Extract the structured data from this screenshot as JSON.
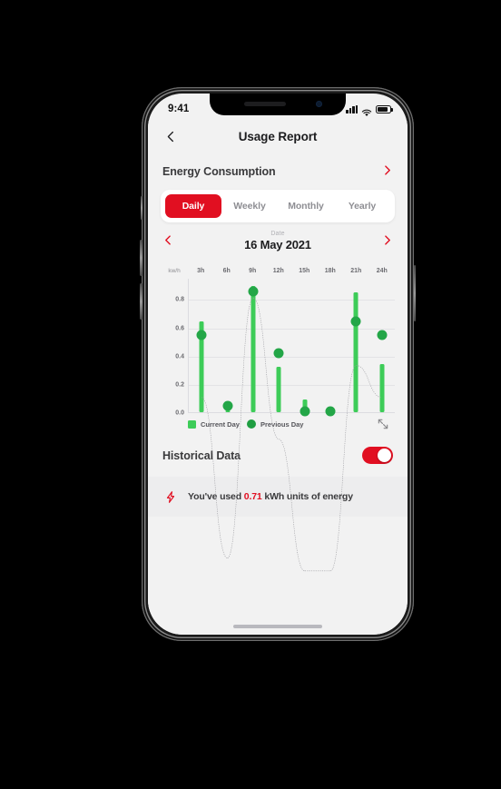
{
  "status_bar": {
    "time": "9:41",
    "signal_icon": "signal-bars-icon",
    "wifi_icon": "wifi-icon",
    "battery_icon": "battery-icon"
  },
  "nav": {
    "back_icon": "chevron-left-icon",
    "title": "Usage Report"
  },
  "section": {
    "title": "Energy Consumption",
    "chevron_icon": "chevron-right-icon"
  },
  "tabs": [
    {
      "label": "Daily",
      "active": true
    },
    {
      "label": "Weekly",
      "active": false
    },
    {
      "label": "Monthly",
      "active": false
    },
    {
      "label": "Yearly",
      "active": false
    }
  ],
  "date_picker": {
    "prev_icon": "chevron-left-icon",
    "next_icon": "chevron-right-icon",
    "label": "Date",
    "value": "16 May 2021"
  },
  "legend": {
    "current_label": "Current Day",
    "previous_label": "Previous Day",
    "expand_icon": "expand-diagonal-icon"
  },
  "historical": {
    "title": "Historical Data",
    "toggle_state": "on"
  },
  "banner": {
    "icon": "lightning-bolt-icon",
    "prefix": "You've used ",
    "value": "0.71",
    "suffix": " kWh units of energy"
  },
  "colors": {
    "brand_red": "#e10f21",
    "bar_green": "#3dcc58",
    "dot_green": "#23a647",
    "screen_bg": "#f2f2f2",
    "card_bg": "#ffffff"
  },
  "chart_data": {
    "type": "bar",
    "title": "",
    "xlabel": "",
    "ylabel": "kw/h",
    "unit_label": "kw/h",
    "categories": [
      "3h",
      "6h",
      "9h",
      "12h",
      "15h",
      "18h",
      "21h",
      "24h"
    ],
    "x_tick_labels": [
      "3h",
      "6h",
      "9h",
      "12h",
      "15h",
      "18h",
      "21h",
      "24h"
    ],
    "y_tick_labels": [
      "0.0",
      "0.2",
      "0.4",
      "0.6",
      "0.8"
    ],
    "y_ticks": [
      0.0,
      0.2,
      0.4,
      0.6,
      0.8
    ],
    "ylim": [
      0,
      0.95
    ],
    "grid": true,
    "legend_position": "bottom-left",
    "series": [
      {
        "name": "Current Day",
        "type": "bar",
        "color": "#3dcc58",
        "values": [
          0.64,
          0.01,
          0.89,
          0.32,
          0.09,
          0.01,
          0.85,
          0.34
        ]
      },
      {
        "name": "Previous Day",
        "type": "scatter-dotted-line",
        "color": "#23a647",
        "values": [
          0.58,
          0.08,
          0.89,
          0.45,
          0.04,
          0.04,
          0.68,
          0.58
        ]
      }
    ]
  }
}
